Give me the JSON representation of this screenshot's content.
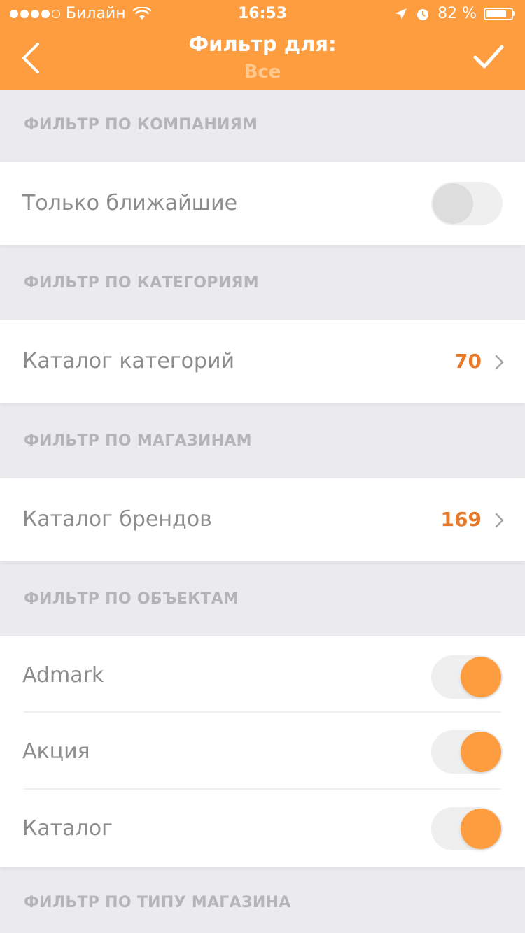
{
  "status_bar": {
    "carrier": "Билайн",
    "time": "16:53",
    "battery": "82 %",
    "battery_level": 0.82
  },
  "nav": {
    "title": "Фильтр для:",
    "subtitle": "Все",
    "back_icon": "chevron-left-icon",
    "confirm_icon": "checkmark-icon"
  },
  "sections": {
    "companies": {
      "title": "ФИЛЬТР ПО КОМПАНИЯМ",
      "items": [
        {
          "label": "Только ближайшие",
          "on": false
        }
      ]
    },
    "categories": {
      "title": "ФИЛЬТР ПО КАТЕГОРИЯМ",
      "item": {
        "label": "Каталог категорий",
        "count": "70"
      }
    },
    "shops": {
      "title": "ФИЛЬТР ПО МАГАЗИНАМ",
      "item": {
        "label": "Каталог брендов",
        "count": "169"
      }
    },
    "objects": {
      "title": "ФИЛЬТР ПО ОБЪЕКТАМ",
      "items": [
        {
          "label": "Admark",
          "on": true
        },
        {
          "label": "Акция",
          "on": true
        },
        {
          "label": "Каталог",
          "on": true
        }
      ]
    },
    "shop_type": {
      "title": "ФИЛЬТР ПО ТИПУ МАГАЗИНА"
    }
  },
  "colors": {
    "accent": "#fe9d40",
    "count": "#e77a2a",
    "background": "#ebebee"
  }
}
